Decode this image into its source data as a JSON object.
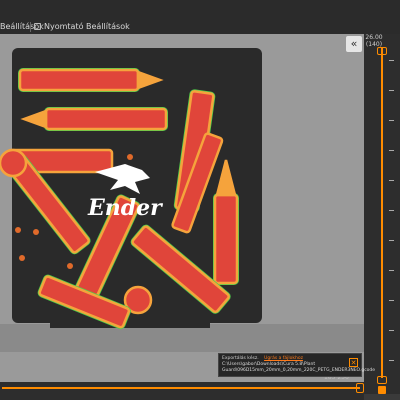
{
  "tabs": [
    {
      "label": "Beállítások"
    },
    {
      "label": "Nyomtató Beállítások"
    }
  ],
  "brand_logo_text": "Ender",
  "layer_slider": {
    "top_value": "26.00",
    "top_layer": "(140)",
    "bottom_layer": "1"
  },
  "horizontal_slider": {
    "counter": "185 236"
  },
  "export_notification": {
    "title": "Exportálás kész.",
    "link_label": "Ugrás a fájlokhoz",
    "path": "C:\\Users\\gabor\\Downloads\\Cura 5.8\\Plant Guard\\096D15mm_20mm_0,20mm_220C_PETG_ENDER3NEO.gcode",
    "close_icon": "close-icon"
  },
  "colors": {
    "accent": "#ff8c00",
    "part_fill": "#e0453a",
    "part_outline": "#f5a33c",
    "support": "#4fd04a",
    "bed": "#2a2a2a",
    "panel": "#2d2d2d"
  }
}
